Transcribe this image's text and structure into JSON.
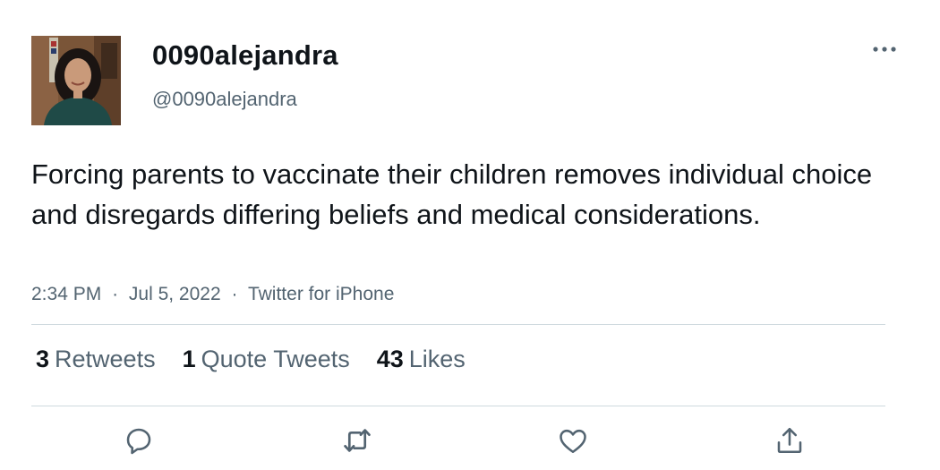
{
  "user": {
    "display_name": "0090alejandra",
    "handle": "@0090alejandra"
  },
  "tweet": {
    "text": "Forcing parents to vaccinate their children removes individual choice and disregards differing beliefs and medical considerations.",
    "time": "2:34 PM",
    "separator": "·",
    "date": "Jul 5, 2022",
    "source": "Twitter for iPhone"
  },
  "stats": {
    "retweets_count": "3",
    "retweets_label": "Retweets",
    "quotes_count": "1",
    "quotes_label": "Quote Tweets",
    "likes_count": "43",
    "likes_label": "Likes"
  },
  "icons": {
    "more": "more-horizontal-icon",
    "reply": "reply-icon",
    "retweet": "retweet-icon",
    "like": "heart-icon",
    "share": "share-icon"
  },
  "colors": {
    "text_primary": "#0f1419",
    "text_secondary": "#536471",
    "divider": "#cfd9de",
    "icon": "#536471"
  }
}
